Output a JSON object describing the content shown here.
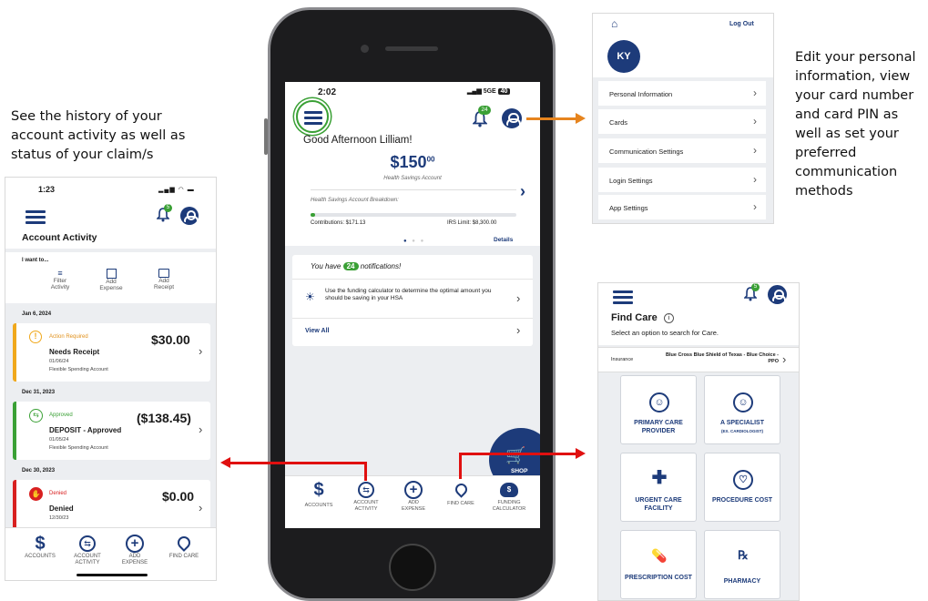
{
  "callouts": {
    "left": "See the history of your account activity as well as status of your claim/s",
    "right": "Edit your personal information, view your card number and card PIN  as well as set your preferred communication methods"
  },
  "colors": {
    "navy": "#1d3b7a",
    "green": "#3aa035",
    "orange": "#e6841e",
    "red": "#e01010"
  },
  "activity": {
    "time": "1:23",
    "title": "Account Activity",
    "bell_count": "5",
    "i_want_to": "I want to...",
    "actions": [
      {
        "label": "Filter Activity",
        "icon": "filter-icon"
      },
      {
        "label": "Add Expense",
        "icon": "receipt-icon"
      },
      {
        "label": "Add Receipt",
        "icon": "image-icon"
      }
    ],
    "groups": [
      {
        "date": "Jan 6, 2024",
        "status": "Action Required",
        "title": "Needs Receipt",
        "date2": "01/06/24",
        "account": "Flexible Spending Account",
        "amount": "$30.00"
      },
      {
        "date": "Dec 31, 2023",
        "status": "Approved",
        "title": "DEPOSIT - Approved",
        "date2": "01/05/24",
        "account": "Flexible Spending Account",
        "amount": "($138.45)"
      },
      {
        "date": "Dec 30, 2023",
        "status": "Denied",
        "title": "Denied",
        "date2": "12/30/23",
        "account": "",
        "amount": "$0.00"
      }
    ],
    "nav": [
      "ACCOUNTS",
      "ACCOUNT ACTIVITY",
      "ADD EXPENSE",
      "FIND CARE"
    ]
  },
  "phone": {
    "time": "2:02",
    "signal": "5GE",
    "battery": "40",
    "bell_count": "24",
    "greeting": "Good Afternoon Lilliam!",
    "balance_main": "$150",
    "balance_cents": "00",
    "account_name": "Health Savings Account",
    "breakdown": "Health Savings Account Breakdown:",
    "contrib_label": "Contributions: $171.13",
    "irs_label": "IRS Limit: $8,300.00",
    "details": "Details",
    "notif_pre": "You have",
    "notif_count": "24",
    "notif_post": "notifications!",
    "tip": "Use the funding calculator to determine the optimal amount you should be saving in your HSA",
    "view_all": "View All",
    "shop": "SHOP",
    "nav": [
      "ACCOUNTS",
      "ACCOUNT ACTIVITY",
      "ADD EXPENSE",
      "FIND CARE",
      "FUNDING CALCULATOR"
    ],
    "contrib_fraction": 0.02
  },
  "profile": {
    "logout": "Log Out",
    "initials": "KY",
    "items": [
      "Personal Information",
      "Cards",
      "Communication Settings",
      "Login Settings",
      "App Settings"
    ]
  },
  "findcare": {
    "bell_count": "5",
    "title": "Find Care",
    "subtitle": "Select an option to search for Care.",
    "insurance_label": "Insurance",
    "insurance_value": "Blue Cross Blue Shield of Texas - Blue Choice - PPO",
    "tiles": [
      {
        "label": "PRIMARY CARE PROVIDER",
        "sub": "",
        "icon": "person-icon"
      },
      {
        "label": "A SPECIALIST",
        "sub": "(EX. CARDIOLOGIST)",
        "icon": "person-icon"
      },
      {
        "label": "URGENT CARE FACILITY",
        "sub": "",
        "icon": "cross-icon"
      },
      {
        "label": "PROCEDURE COST",
        "sub": "",
        "icon": "heart-pulse-icon"
      },
      {
        "label": "PRESCRIPTION COST",
        "sub": "",
        "icon": "pills-icon"
      },
      {
        "label": "PHARMACY",
        "sub": "",
        "icon": "rx-icon"
      }
    ]
  }
}
